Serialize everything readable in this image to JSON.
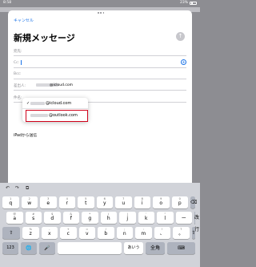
{
  "status": {
    "time": "8:58",
    "battery": "23%"
  },
  "compose": {
    "cancel": "キャンセル",
    "title": "新規メッセージ",
    "send_icon": "arrow-up-icon",
    "fields": {
      "to": "宛先:",
      "cc": "Cc:",
      "bcc": "Bcc:",
      "from_label": "差出人:",
      "from_value": "@icloud.com",
      "subject": "件名:"
    },
    "from_options": [
      {
        "email": "@icloud.com",
        "checked": true
      },
      {
        "email": "@outlook.com",
        "checked": false
      }
    ],
    "signature": "iPadから送信",
    "highlight_color": "#d0021b"
  },
  "keyboard": {
    "toolbar": {
      "undo": "↶",
      "redo": "↷",
      "paste": "⧉"
    },
    "row1": [
      {
        "sub": "1",
        "main": "q"
      },
      {
        "sub": "2",
        "main": "w"
      },
      {
        "sub": "3",
        "main": "e"
      },
      {
        "sub": "4",
        "main": "r"
      },
      {
        "sub": "5",
        "main": "t"
      },
      {
        "sub": "6",
        "main": "y"
      },
      {
        "sub": "7",
        "main": "u"
      },
      {
        "sub": "8",
        "main": "i"
      },
      {
        "sub": "9",
        "main": "o"
      },
      {
        "sub": "0",
        "main": "p"
      }
    ],
    "row2": [
      {
        "sub": "@",
        "main": "a"
      },
      {
        "sub": "#",
        "main": "s"
      },
      {
        "sub": "$",
        "main": "d"
      },
      {
        "sub": "&",
        "main": "f"
      },
      {
        "sub": "*",
        "main": "g"
      },
      {
        "sub": "(",
        "main": "h"
      },
      {
        "sub": ")",
        "main": "j"
      },
      {
        "sub": "'",
        "main": "k"
      },
      {
        "sub": "\"",
        "main": "l"
      },
      {
        "sub": "",
        "main": "ー"
      }
    ],
    "row3": [
      {
        "sub": "%",
        "main": "z"
      },
      {
        "sub": "-",
        "main": "x"
      },
      {
        "sub": "+",
        "main": "c"
      },
      {
        "sub": "=",
        "main": "v"
      },
      {
        "sub": "/",
        "main": "b"
      },
      {
        "sub": ";",
        "main": "n"
      },
      {
        "sub": ":",
        "main": "m"
      },
      {
        "sub": "!",
        "main": "、"
      },
      {
        "sub": "?",
        "main": "。"
      }
    ],
    "backspace": "⌫",
    "return": "改行",
    "shift": "⇧",
    "numbers": "123",
    "globe": "🌐",
    "mic": "🎤",
    "space": "",
    "aiueo": "あいう",
    "zenkaku": "全角",
    "hide": "⌨"
  }
}
